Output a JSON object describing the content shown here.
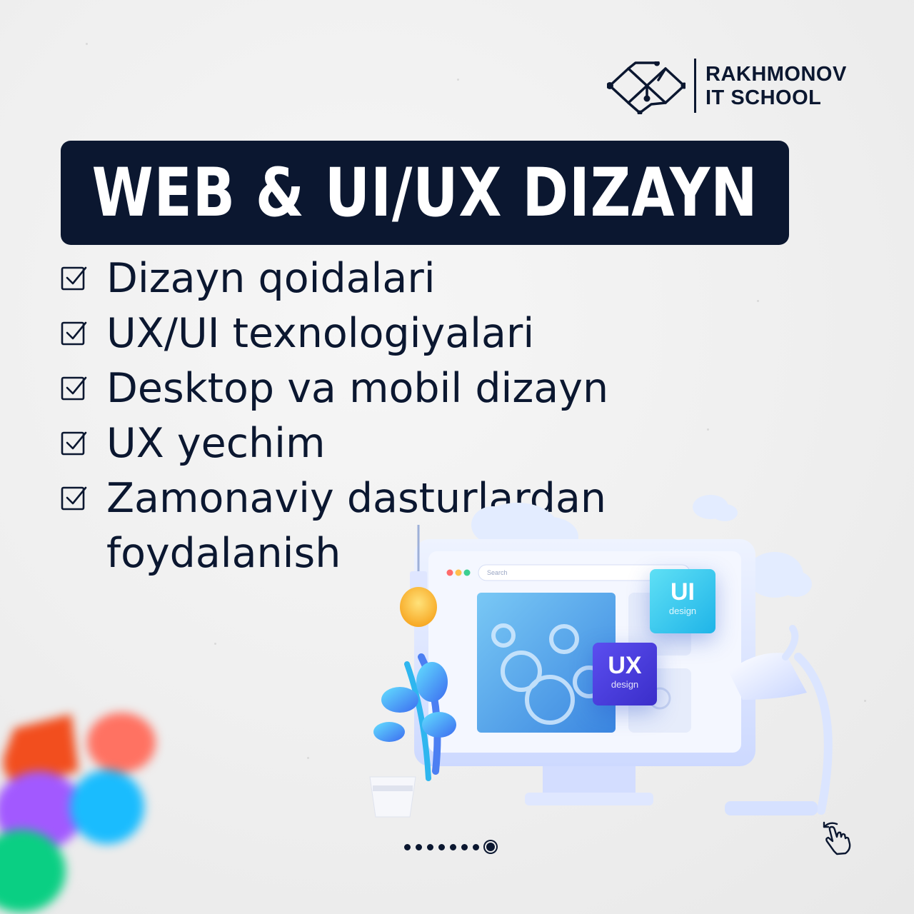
{
  "brand": {
    "line1": "RAKHMONOV",
    "line2": "IT SCHOOL",
    "logo_icon": "circuit-diamond-logo-icon",
    "color": "#0b1730"
  },
  "title": "WEB & UI/UX DIZAYN",
  "features": [
    "Dizayn qoidalari",
    "UX/UI texnologiyalari",
    "Desktop va mobil dizayn",
    "UX yechim",
    "Zamonaviy dasturlardan foydalanish"
  ],
  "feature_icon": "checkbox-checked-icon",
  "illustration": {
    "search_placeholder": "Search",
    "ui_card": {
      "big": "UI",
      "small": "design",
      "color": "#1fb4e8"
    },
    "ux_card": {
      "big": "UX",
      "small": "design",
      "color": "#3a2ec9"
    }
  },
  "pager": {
    "total": 8,
    "active_index": 7
  },
  "swipe_icon": "swipe-hand-icon",
  "decor_icon": "figma-logo-icon",
  "colors": {
    "navy": "#0b1730",
    "background": "#efefef",
    "figma_red": "#f24e1e",
    "figma_salmon": "#ff7262",
    "figma_purple": "#a259ff",
    "figma_blue": "#1abcfe",
    "figma_green": "#0acf83"
  }
}
